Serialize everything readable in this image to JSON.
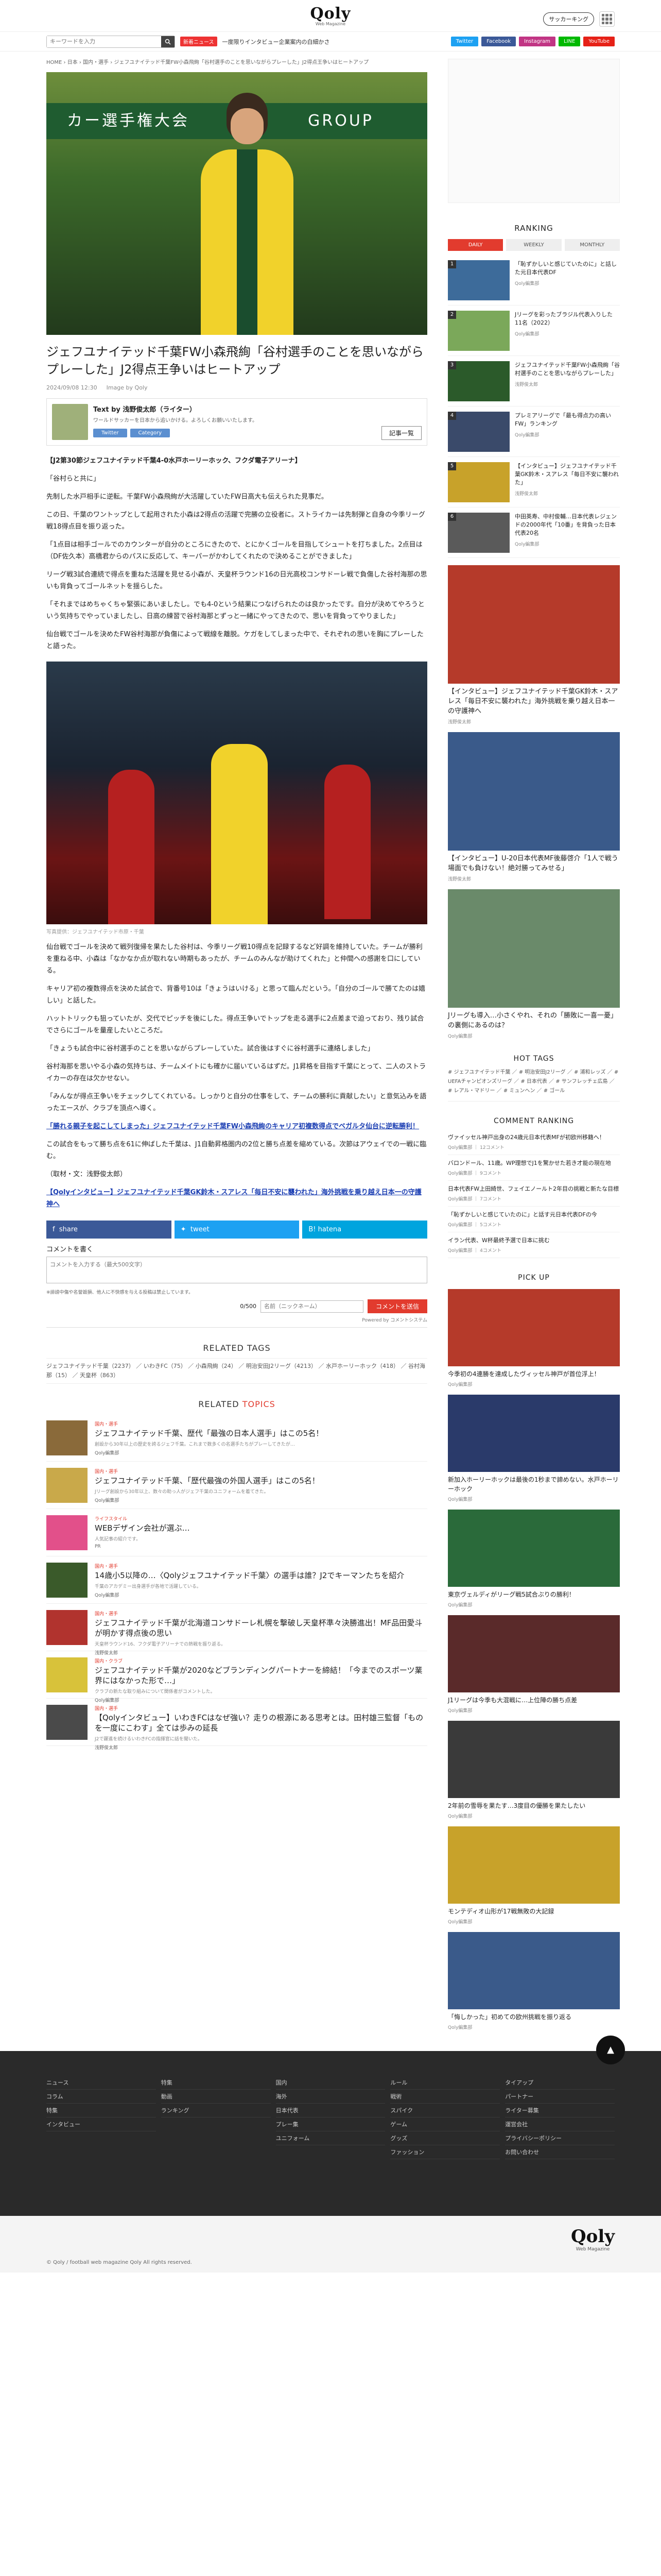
{
  "header": {
    "logo_text": "Qoly",
    "logo_sub": "Web Magazine",
    "soccer_king_label": "サッカーキング",
    "search_placeholder": "キーワードを入力",
    "new_badge": "新着ニュース",
    "ticker": "一度限りインタビュー企業案内の白細かさ",
    "socials": [
      {
        "label": "Twitter",
        "color": "#1da1f2"
      },
      {
        "label": "Facebook",
        "color": "#3b5998"
      },
      {
        "label": "Instagram",
        "color": "#c13584"
      },
      {
        "label": "LINE",
        "color": "#00b900"
      },
      {
        "label": "YouTube",
        "color": "#e62117"
      }
    ]
  },
  "breadcrumb": "HOME › 日本 › 国内・選手 › ジェフユナイテッド千葉FW小森飛絢「谷村選手のことを思いながらプレーした」J2得点王争いはヒートアップ",
  "article": {
    "title": "ジェフユナイテッド千葉FW小森飛絢「谷村選手のことを思いながらプレーした」J2得点王争いはヒートアップ",
    "date": "2024/09/08 12:30",
    "image_credit": "Image by Qoly",
    "author": {
      "name": "浅野俊太郎（ライター）",
      "desc": "ワールドサッカーを日本から追いかける。よろしくお願いいたします。",
      "tags": [
        "Twitter",
        "Category"
      ],
      "list_button": "記事一覧"
    },
    "lead": "【J2第30節ジェフユナイテッド千葉4-0水戸ホーリーホック、フクダ電子アリーナ】",
    "paragraphs": [
      "「谷村らと共に」",
      "先制した水戸相手に逆転。千葉FW小森飛絢が大活躍していたFW日高大も伝えられた見事だ。",
      "この日、千葉のワントップとして起用された小森は2得点の活躍で完勝の立役者に。ストライカーは先制弾と自身の今季リーグ戦18得点目を振り返った。",
      "「1点目は相手ゴールでのカウンターが自分のところにきたので、とにかくゴールを目指してシュートを打ちました。2点目は（DF佐久本）高橋君からのパスに反応して、キーパーがかわしてくれたので決めることができました」",
      "リーグ戦3試合連続で得点を重ねた活躍を見せる小森が、天皇杯ラウンド16の日光高校コンサドーレ戦で負傷した谷村海那の思いも背負ってゴールネットを揺らした。",
      "「それまではめちゃくちゃ緊張にあいましたし。でも4-0という結果につなげられたのは良かったです。自分が決めてやろうという気持ちでやっていましたし、日高の練習で谷村海那とずっと一緒にやってきたので、思いを背負ってやりました」",
      "仙台戦でゴールを決めたFW谷村海那が負傷によって戦線を離脱。ケガをしてしまった中で、それぞれの思いを胸にプレーしたと語った。"
    ],
    "photo_caption": "写真提供：ジェフユナイテッド市原・千葉",
    "paragraphs2": [
      "仙台戦でゴールを決めて戦列復帰を果たした谷村は、今季リーグ戦10得点を記録するなど好調を維持していた。チームが勝利を重ねる中、小森は「なかなか点が取れない時期もあったが、チームのみんなが助けてくれた」と仲間への感謝を口にしている。",
      "キャリア初の複数得点を決めた試合で、背番号10は「きょうはいける」と思って臨んだという。「自分のゴールで勝てたのは嬉しい」と話した。",
      "ハットトリックも狙っていたが、交代でピッチを後にした。得点王争いでトップを走る選手に2点差まで迫っており、残り試合でさらにゴールを量産したいところだ。",
      "「きょうも試合中に谷村選手のことを思いながらプレーしていた。試合後はすぐに谷村選手に連絡しました」",
      "谷村海那を思いやる小森の気持ちは、チームメイトにも確かに届いているはずだ。J1昇格を目指す千葉にとって、二人のストライカーの存在は欠かせない。",
      "「みんなが得点王争いをチェックしてくれている。しっかりと自分の仕事をして、チームの勝利に貢献したい」と意気込みを語ったエースが、クラブを頂点へ導く。"
    ],
    "link1": "「勝れる親子を起こしてしまった」ジェフユナイテッド千葉FW小森飛絢のキャリア初複数得点でベガルタ仙台に逆転勝利！",
    "extra_para": "この試合をもって勝ち点を61に伸ばした千葉は、J1自動昇格圏内の2位と勝ち点差を縮めている。次節はアウェイでの一戦に臨む。",
    "author_line": "（取材・文：浅野俊太郎）",
    "link2": "【Qolyインタビュー】ジェフユナイテッド千葉GK鈴木・スアレス「毎日不安に襲われた」海外挑戦を乗り越え日本一の守護神へ"
  },
  "share": [
    {
      "label": "share",
      "color": "#3b5998"
    },
    {
      "label": "tweet",
      "color": "#1da1f2"
    },
    {
      "label": "B! hatena",
      "color": "#00a4de"
    }
  ],
  "comments": {
    "label": "コメントを書く",
    "placeholder": "コメントを入力する（最大500文字）",
    "note": "※誹謗中傷や名誉毀損、他人に不快感を与える投稿は禁止しています。",
    "count": "0/500",
    "nick_placeholder": "名前（ニックネーム）",
    "send": "コメントを送信",
    "powered": "Powered by コメントシステム"
  },
  "related_tags": {
    "title": "RELATED TAGS",
    "items": "ジェフユナイテッド千葉（2237） ／ いわきFC（75） ／ 小森飛絢（24） ／ 明治安田J2リーグ（4213） ／ 水戸ホーリーホック（418） ／ 谷村海那（15） ／ 天皇杯（863）"
  },
  "related_topics": {
    "title_prefix": "RELATED",
    "title_suffix": "TOPICS",
    "items": [
      {
        "cat": "国内・選手",
        "title": "ジェフユナイテッド千葉、歴代「最強の日本人選手」はこの5名！",
        "ex": "創設から30年以上の歴史を誇るジェフ千葉。これまで数多くの名選手たちがプレーしてきたが…",
        "au": "Qoly編集部",
        "color": "#8a6a3a"
      },
      {
        "cat": "国内・選手",
        "title": "ジェフユナイテッド千葉、「歴代最強の外国人選手」はこの5名！",
        "ex": "Jリーグ創設から30年以上、数々の助っ人がジェフ千葉のユニフォームを着てきた。",
        "au": "Qoly編集部",
        "color": "#c9a94a"
      },
      {
        "cat": "ライフスタイル",
        "title": "WEBデザイン会社が選ぶ…",
        "ex": "人気記事の紹介です。",
        "au": "PR",
        "color": "#e2508a"
      },
      {
        "cat": "国内・選手",
        "title": "14歳小5以降の…〈Qolyジェフユナイテッド千葉〉の選手は誰？J2でキーマンたちを紹介",
        "ex": "千葉のアカデミー出身選手が各地で活躍している。",
        "au": "Qoly編集部",
        "color": "#3a5a2a"
      },
      {
        "cat": "国内・選手",
        "title": "ジェフユナイテッド千葉が北海道コンサドーレ札幌を撃破し天皇杯準々決勝進出！MF品田愛斗が明かす得点後の思い",
        "ex": "天皇杯ラウンド16、フクダ電子アリーナでの熱戦を振り返る。",
        "au": "浅野俊太郎",
        "color": "#b1332e"
      },
      {
        "cat": "国内・クラブ",
        "title": "ジェフユナイテッド千葉が2020などブランディングパートナーを締結！「今までのスポーツ業界にはなかった形で…」",
        "ex": "クラブの新たな取り組みについて関係者がコメントした。",
        "au": "Qoly編集部",
        "color": "#d8c23a"
      },
      {
        "cat": "国内・選手",
        "title": "【Qolyインタビュー】いわきFCはなぜ強い？走りの根源にある思考とは。田村雄三監督「ものを一度にこわす」全ては歩みの延長",
        "ex": "J2で躍進を続けるいわきFCの指揮官に話を聞いた。",
        "au": "浅野俊太郎",
        "color": "#4a4a4a"
      }
    ]
  },
  "sidebar": {
    "ranking_title": "RANKING",
    "tabs": [
      "DAILY",
      "WEEKLY",
      "MONTHLY"
    ],
    "ranking": [
      {
        "title": "「恥ずかしいと感じていたのに」と話した元日本代表DF",
        "au": "Qoly編集部",
        "color": "#3d6b9a"
      },
      {
        "title": "Jリーグを彩ったブラジル代表入りした11名（2022）",
        "au": "Qoly編集部",
        "color": "#7ba85a"
      },
      {
        "title": "ジェフユナイテッド千葉FW小森飛絢「谷村選手のことを思いながらプレーした」",
        "au": "浅野俊太郎",
        "color": "#2b5a2a"
      },
      {
        "title": "プレミアリーグで「最も得点力の高いFW」ランキング",
        "au": "Qoly編集部",
        "color": "#3a4a6a"
      },
      {
        "title": "【インタビュー】ジェフユナイテッド千葉GK鈴木・スアレス「毎日不安に襲われた」",
        "au": "浅野俊太郎",
        "color": "#c8a22a"
      },
      {
        "title": "中田英寿、中村俊輔…日本代表レジェンドの2000年代「10番」を背負った日本代表20名",
        "au": "Qoly編集部",
        "color": "#5a5a5a"
      }
    ],
    "big1": {
      "title": "【インタビュー】ジェフユナイテッド千葉GK鈴木・スアレス「毎日不安に襲われた」海外挑戦を乗り越え日本一の守護神へ",
      "au": "浅野俊太郎",
      "color": "#b53a2a"
    },
    "big2": {
      "title": "【インタビュー】U-20日本代表MF後藤啓介「1人で戦う場面でも負けない！絶対勝ってみせる」",
      "au": "浅野俊太郎",
      "color": "#3a5a8a"
    },
    "big3": {
      "title": "Jリーグも導入…小さくやれ、それの「勝敗に一喜一憂」の裏側にあるのは？",
      "au": "Qoly編集部",
      "color": "#6a8a6a"
    },
    "hot_title": "HOT TAGS",
    "hot_tags": "# ジェフユナイテッド千葉 ／ # 明治安田J2リーグ ／ # 浦和レッズ ／ # UEFAチャンピオンズリーグ ／ # 日本代表 ／ # サンフレッチェ広島 ／ # レアル・マドリー ／ # ミュンヘン ／ # ゴール",
    "comment_ranking_title": "COMMENT RANKING",
    "comment_ranking": [
      {
        "t": "ヴァイッセル神戸出身の24歳元日本代表MFが初欧州移籍へ！",
        "a": "Qoly編集部 ｜ 12コメント"
      },
      {
        "t": "バロンドール、11歳。WP理想でJ1を驚かせた若き才能の現在地",
        "a": "Qoly編集部 ｜ 9コメント"
      },
      {
        "t": "日本代表FW上田綺世、フェイエノールト2年目の挑戦と新たな目標",
        "a": "Qoly編集部 ｜ 7コメント"
      },
      {
        "t": "「恥ずかしいと感じていたのに」と話す元日本代表DFの今",
        "a": "Qoly編集部 ｜ 5コメント"
      },
      {
        "t": "イラン代表、W杯最終予選で日本に挑む",
        "a": "Qoly編集部 ｜ 4コメント"
      }
    ],
    "pick_title": "PICK UP",
    "pick": [
      {
        "t": "今季初の4連勝を達成したヴィッセル神戸が首位浮上！",
        "a": "Qoly編集部",
        "color": "#b53a2a"
      },
      {
        "t": "新加入ホーリーホックは最後の1秒まで諦めない。水戸ホーリーホック",
        "a": "Qoly編集部",
        "color": "#2a3a6a"
      },
      {
        "t": "東京ヴェルディがリーグ戦5試合ぶりの勝利！",
        "a": "Qoly編集部",
        "color": "#2a6a3a"
      },
      {
        "t": "J1リーグは今季も大混戦に…上位陣の勝ち点差",
        "a": "Qoly編集部",
        "color": "#5a2a2a"
      },
      {
        "t": "2年前の雪辱を果たす…3度目の優勝を果たしたい",
        "a": "Qoly編集部",
        "color": "#3a3a3a"
      },
      {
        "t": "モンテディオ山形が17戦無敗の大記録",
        "a": "Qoly編集部",
        "color": "#c8a22a"
      },
      {
        "t": "「悔しかった」初めての欧州挑戦を振り返る",
        "a": "Qoly編集部",
        "color": "#3a5a8a"
      }
    ]
  },
  "footer": {
    "cols": [
      [
        "ニュース",
        "コラム",
        "特集",
        "インタビュー"
      ],
      [
        "特集",
        "動画",
        "ランキング"
      ],
      [
        "国内",
        "海外",
        "日本代表",
        "プレー集",
        "ユニフォーム"
      ],
      [
        "ルール",
        "戦術",
        "スパイク",
        "ゲーム",
        "グッズ",
        "ファッション"
      ],
      [
        "タイアップ",
        "パートナー",
        "ライター募集",
        "運営会社",
        "プライバシーポリシー",
        "お問い合わせ"
      ]
    ],
    "totop": "▲",
    "copyright": "© Qoly / football web magazine Qoly All rights reserved."
  }
}
